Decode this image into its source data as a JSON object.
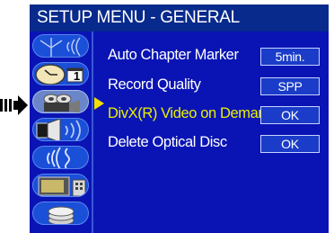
{
  "header": {
    "title": "SETUP MENU - GENERAL"
  },
  "sidebar": {
    "categories": [
      {
        "icon": "antenna-icon"
      },
      {
        "icon": "clock-calendar-icon",
        "number": "1"
      },
      {
        "icon": "video-camera-icon",
        "selected": true
      },
      {
        "icon": "speaker-icon"
      },
      {
        "icon": "wireless-signal-icon"
      },
      {
        "icon": "tv-remote-icon"
      },
      {
        "icon": "disc-stack-icon"
      }
    ]
  },
  "settings": [
    {
      "label": "Auto Chapter Marker",
      "value": "5min."
    },
    {
      "label": "Record Quality",
      "value": "SPP"
    },
    {
      "label": "DivX(R) Video on Demand",
      "value": "OK",
      "highlighted": true
    },
    {
      "label": "Delete Optical Disc",
      "value": "OK"
    }
  ],
  "colors": {
    "background": "#0a14b4",
    "title_bar": "#082a8c",
    "highlight_text": "#eaf000",
    "arrow": "#f3e000"
  }
}
